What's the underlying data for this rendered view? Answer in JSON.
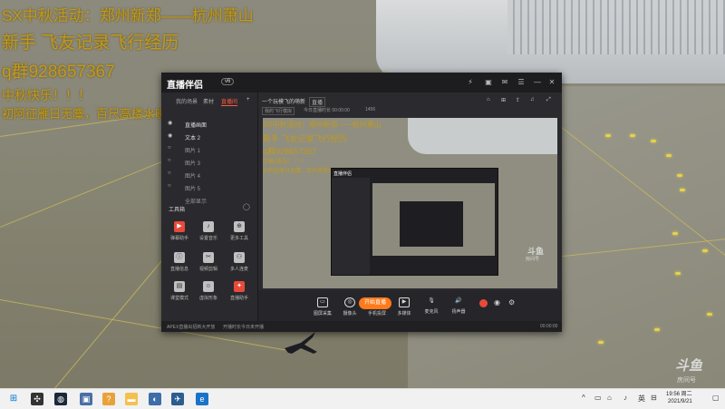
{
  "overlay": {
    "line1": "SX中秋活动：郑州新郑——杭州萧山",
    "line2": "新手 飞友记录飞行经历",
    "line3": "q群928657367",
    "line4": "中秋快乐！！！",
    "line5": "初阿征雁日无麋，百尺高楼水暖天"
  },
  "app": {
    "title": "直播伴侣",
    "version": "v6",
    "sidebar_tabs": [
      "我的场景",
      "素材",
      "直播间"
    ],
    "sources": [
      "直播画面",
      "文本 2",
      "图片 1",
      "图片 3",
      "图片 4",
      "图片 5",
      "全部显示"
    ],
    "tools_title": "工具箱",
    "tools": [
      {
        "label": "弹幕助手",
        "icon": "danmu-icon"
      },
      {
        "label": "设置音乐",
        "icon": "music-icon"
      },
      {
        "label": "更多工具",
        "icon": "more-icon"
      },
      {
        "label": "直播信息",
        "icon": "info-icon"
      },
      {
        "label": "视频剪辑",
        "icon": "clip-icon"
      },
      {
        "label": "多人连麦",
        "icon": "mic-icon"
      },
      {
        "label": "课堂模式",
        "icon": "class-icon"
      },
      {
        "label": "虚拟形象",
        "icon": "avatar-icon"
      },
      {
        "label": "直播助手",
        "icon": "helper-icon"
      }
    ],
    "main_tab": "一个玩模飞的萌新",
    "main_tab_badge": "直播",
    "main_tab_sub": "我的飞行模拟",
    "main_stats": "今日直播时长 00:00:00",
    "main_fans": "1456",
    "bottom_tools": [
      "图屏采集",
      "摄像头",
      "手机投屏",
      "多媒体",
      "麦克风",
      "扬声器"
    ],
    "live_button": "开始直播",
    "status_left": "APEX直播出招新大开放",
    "status_mid": "开播时长今日未开播",
    "status_right": "00:00:00",
    "watermark_top": "斗鱼",
    "watermark_sub": "房间号"
  },
  "watermark": {
    "brand": "斗鱼",
    "sub": "房间号"
  },
  "taskbar": {
    "tray_lang": "英",
    "time": "19:56 周二",
    "date": "2021/9/21"
  },
  "colors": {
    "accent": "#ff7a1a",
    "overlay_text": "#c29a1e",
    "app_bg": "#242427"
  }
}
